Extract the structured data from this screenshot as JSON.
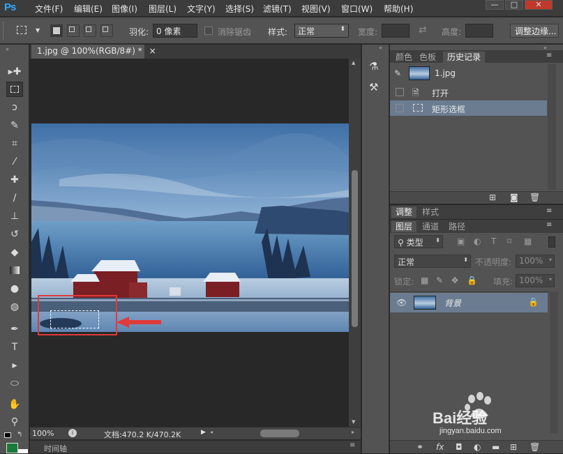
{
  "app": {
    "logo": "Ps"
  },
  "menu": [
    "文件(F)",
    "编辑(E)",
    "图像(I)",
    "图层(L)",
    "文字(Y)",
    "选择(S)",
    "滤镜(T)",
    "视图(V)",
    "窗口(W)",
    "帮助(H)"
  ],
  "window_controls": {
    "minimize": "—",
    "restore": "□",
    "close": "✕"
  },
  "options": {
    "feather_label": "羽化:",
    "feather_value": "0 像素",
    "antialias_label": "消除锯齿",
    "style_label": "样式:",
    "style_value": "正常",
    "width_label": "宽度:",
    "height_label": "高度:",
    "refine_edge_button": "调整边缘..."
  },
  "document": {
    "tab_title": "1.jpg @ 100%(RGB/8#) *",
    "tab_close": "×",
    "zoom": "100%",
    "doc_size": "文档:470.2 K/470.2K",
    "timeline_label": "时间轴"
  },
  "history_panel": {
    "tabs": [
      "颜色",
      "色板",
      "历史记录"
    ],
    "active_tab": "历史记录",
    "snapshot_name": "1.jpg",
    "steps": [
      "打开",
      "矩形选框"
    ]
  },
  "adjust_panel": {
    "tabs": [
      "调整",
      "样式"
    ],
    "active_tab": "调整"
  },
  "layers_panel": {
    "tabs": [
      "图层",
      "通道",
      "路径"
    ],
    "active_tab": "图层",
    "filter_kind": "类型",
    "blend_mode": "正常",
    "opacity_label": "不透明度:",
    "opacity_value": "100%",
    "lock_label": "锁定:",
    "fill_label": "填充:",
    "fill_value": "100%",
    "layers": [
      {
        "name": "背景",
        "visible": true,
        "locked": true
      }
    ]
  },
  "watermark": {
    "text": "Bai经验",
    "url": "jingyan.baidu.com"
  },
  "colors": {
    "accent_ps": "#31a8ff",
    "annotation_red": "#e03a3a",
    "history_selected": "#6b7c91"
  }
}
